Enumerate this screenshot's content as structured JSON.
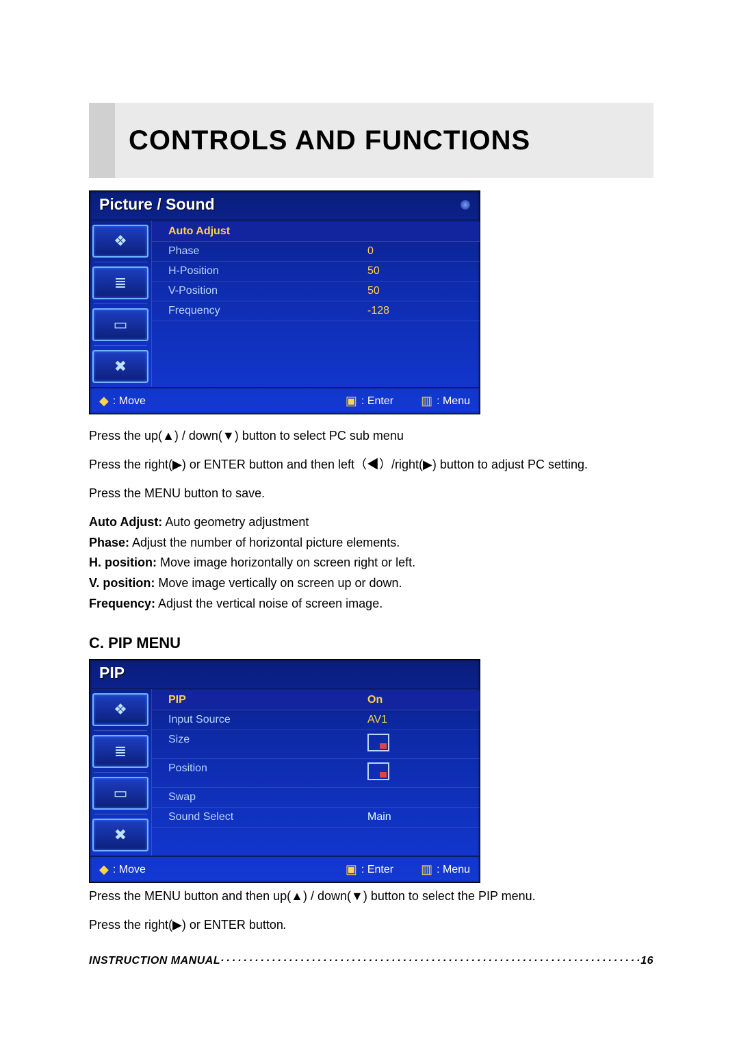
{
  "header": {
    "title": "CONTROLS AND FUNCTIONS"
  },
  "osd1": {
    "title": "Picture / Sound",
    "rows": [
      {
        "label": "Auto Adjust",
        "value": ""
      },
      {
        "label": "Phase",
        "value": "0"
      },
      {
        "label": "H-Position",
        "value": "50"
      },
      {
        "label": "V-Position",
        "value": "50"
      },
      {
        "label": "Frequency",
        "value": "-128"
      }
    ],
    "hints": {
      "move": ": Move",
      "enter": ": Enter",
      "menu": ": Menu"
    }
  },
  "text1": {
    "p1a": "Press the up(",
    "p1b": ") / down(",
    "p1c": ") button to select PC sub menu",
    "p2a": "Press the right(",
    "p2b": ") or ENTER button and then left（",
    "p2b2": "）/right(",
    "p2c": ") button to adjust PC setting.",
    "p3": "Press the MENU button to save.",
    "defs": [
      {
        "term": "Auto Adjust:",
        "desc": " Auto geometry adjustment"
      },
      {
        "term": "Phase:",
        "desc": " Adjust the number of horizontal picture elements."
      },
      {
        "term": "H. position:",
        "desc": " Move image horizontally on screen right or left."
      },
      {
        "term": "V. position:",
        "desc": " Move image vertically on screen up or down."
      },
      {
        "term": "Frequency:",
        "desc": " Adjust the vertical noise of screen image."
      }
    ]
  },
  "sectionC": "C. PIP MENU",
  "osd2": {
    "title": "PIP",
    "rows": [
      {
        "label": "PIP",
        "value": "On"
      },
      {
        "label": "Input Source",
        "value": "AV1"
      },
      {
        "label": "Size",
        "value": "icon-br"
      },
      {
        "label": "Position",
        "value": "icon-br"
      },
      {
        "label": "Swap",
        "value": ""
      },
      {
        "label": "Sound Select",
        "value": "Main"
      }
    ],
    "hints": {
      "move": ": Move",
      "enter": ": Enter",
      "menu": ": Menu"
    }
  },
  "text2": {
    "p1a": "Press the MENU button and then up(",
    "p1b": ") / down(",
    "p1c": ") button to select the PIP menu.",
    "p2a": "Press the right(",
    "p2b": ") or ENTER button",
    "p2c": "."
  },
  "footer": {
    "label": "INSTRUCTION MANUAL",
    "page": "16"
  },
  "glyphs": {
    "up": "▲",
    "down": "▼",
    "left": "◀",
    "right": "▶",
    "updown": "◆",
    "enter": "▣",
    "menu": "▥"
  }
}
